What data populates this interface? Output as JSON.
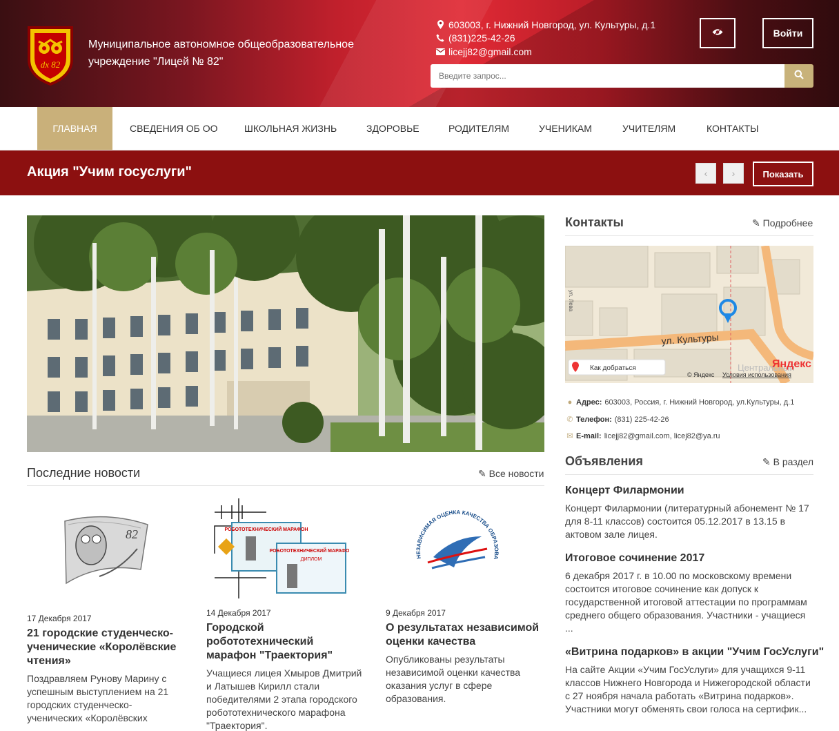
{
  "header": {
    "org_name": "Муниципальное автономное общеобразовательное учреждение \"Лицей № 82\"",
    "logo_text": "dx 82",
    "address": "603003, г. Нижний Новгород, ул. Культуры, д.1",
    "phone": "(831)225-42-26",
    "email": "licejj82@gmail.com",
    "login_label": "Войти",
    "search_placeholder": "Введите запрос...",
    "icons": {
      "accessibility": "eye-icon",
      "search": "search-icon"
    }
  },
  "nav": {
    "items": [
      {
        "label": "ГЛАВНАЯ",
        "active": true
      },
      {
        "label": "СВЕДЕНИЯ ОБ ОО"
      },
      {
        "label": "ШКОЛЬНАЯ ЖИЗНЬ"
      },
      {
        "label": "ЗДОРОВЬЕ"
      },
      {
        "label": "РОДИТЕЛЯМ"
      },
      {
        "label": "УЧЕНИКАМ"
      },
      {
        "label": "УЧИТЕЛЯМ"
      },
      {
        "label": "КОНТАКТЫ"
      }
    ]
  },
  "promo": {
    "title": "Акция \"Учим госуслуги\"",
    "prev": "‹",
    "next": "›",
    "show_label": "Показать"
  },
  "news": {
    "title": "Последние новости",
    "all_link": "Все новости",
    "items": [
      {
        "date": "17 Декабря 2017",
        "title": "21 городские студенческо-ученические «Королёвские чтения»",
        "text": "Поздравляем Рунову Марину с успешным выступлением на  21 городских студенческо-ученических «Королёвских чтениях»",
        "img_text": "82"
      },
      {
        "date": "14 Декабря 2017",
        "title": "Городской робототехнический марафон \"Траектория\"",
        "text": "Учащиеся лицея Хмыров Дмитрий и Латышев Кирилл стали победителями 2 этапа городского робототехнического марафона \"Траектория\".",
        "img_text": "РОБОТОТЕХНИЧЕСКИЙ МАРАФОН",
        "img_sub": "ДИПЛОМ"
      },
      {
        "date": "9 Декабря 2017",
        "title": "О результатах независимой оценки качества",
        "text": "Опубликованы результаты независимой оценки качества оказания услуг в сфере образования.",
        "img_text": "НЕЗАВИСИМАЯ ОЦЕНКА КАЧЕСТВА ОБРАЗОВАНИЯ"
      }
    ]
  },
  "contacts": {
    "title": "Контакты",
    "more_link": "Подробнее",
    "map": {
      "street": "ул. Культуры",
      "route_label": "Как добраться",
      "brand": "Яндекс",
      "copyright": "© Яндекс",
      "terms": "Условия использования",
      "area_label": "Центральный",
      "side_label": "ул. Лева"
    },
    "address_label": "Адрес:",
    "address": "603003, Россия, г. Нижний Новгород, ул.Культуры, д.1",
    "phone_label": "Телефон:",
    "phone": "(831) 225-42-26",
    "email_label": "E-mail:",
    "email": "licejj82@gmail.com, licej82@ya.ru"
  },
  "announcements": {
    "title": "Объявления",
    "section_link": "В раздел",
    "items": [
      {
        "title": "Концерт Филармонии",
        "text": "Концерт Филармонии (литературный абонемент № 17 для 8-11 классов) состоится 05.12.2017  в 13.15 в актовом зале лицея."
      },
      {
        "title": "Итоговое сочинение 2017",
        "text": "6 декабря 2017 г. в 10.00 по московскому времени состоится итоговое сочинение как допуск к государственной итоговой аттестации по программам среднего общего образования. Участники - учащиеся ..."
      },
      {
        "title": "«Витрина подарков» в акции \"Учим ГосУслуги\"",
        "text": "На сайте Акции «Учим ГосУслуги» для учащихся 9-11 классов Нижнего Новгорода и Нижегородской области с 27 ноября начала работать «Витрина подарков». Участники могут обменять свои голоса на сертифик..."
      }
    ]
  }
}
